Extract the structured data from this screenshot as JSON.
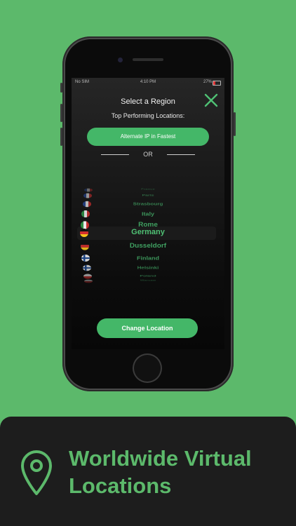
{
  "status_bar": {
    "carrier": "No SIM",
    "time": "4:10 PM",
    "battery": "27%"
  },
  "screen": {
    "title": "Select a Region",
    "subtitle": "Top Performing Locations:",
    "fast_button": "Alternate IP in Fastest",
    "or_text": "OR",
    "change_button": "Change Location"
  },
  "picker": {
    "selected": "Germany",
    "items": [
      {
        "label": "France",
        "flag": "france-flag"
      },
      {
        "label": "Paris",
        "flag": "france-flag"
      },
      {
        "label": "Strasbourg",
        "flag": "france-flag"
      },
      {
        "label": "Italy",
        "flag": "italy-flag"
      },
      {
        "label": "Rome",
        "flag": "italy-flag"
      },
      {
        "label": "Germany",
        "flag": "germany-flag"
      },
      {
        "label": "Dusseldorf",
        "flag": "germany-flag"
      },
      {
        "label": "Finland",
        "flag": "finland-flag"
      },
      {
        "label": "Helsinki",
        "flag": "finland-flag"
      },
      {
        "label": "Poland",
        "flag": "poland-flag"
      },
      {
        "label": "Warsaw",
        "flag": "poland-flag"
      }
    ]
  },
  "promo": {
    "headline_line1": "Worldwide Virtual",
    "headline_line2": "Locations"
  },
  "colors": {
    "accent": "#44b768",
    "background": "#5cb96b",
    "panel": "#1d1d1d"
  }
}
